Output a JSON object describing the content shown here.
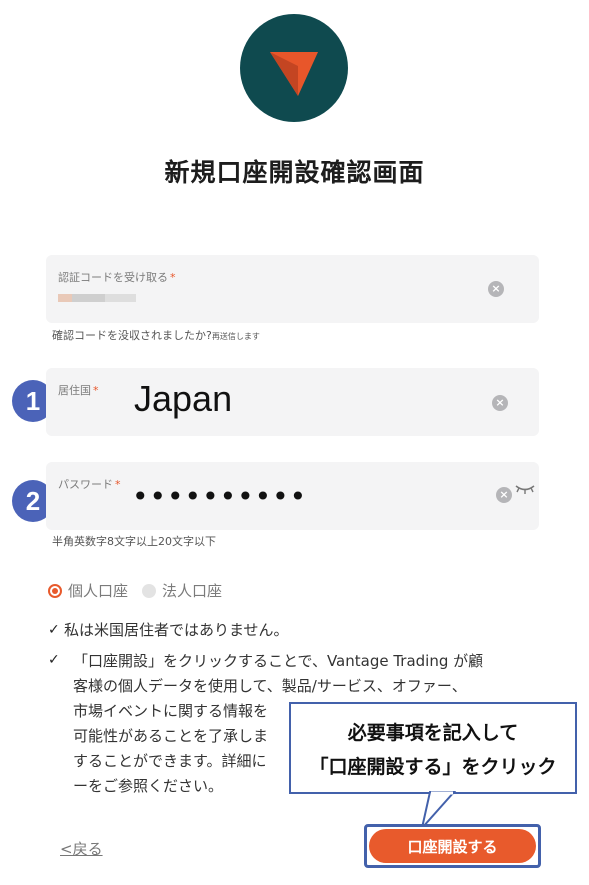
{
  "header": {
    "title": "新規口座開設確認画面"
  },
  "verification": {
    "label": "認証コードを受け取る",
    "required_mark": "*",
    "hint_main": "確認コードを没収されましたか?",
    "hint_link": "再送信します"
  },
  "residence": {
    "label": "居住国",
    "required_mark": "*",
    "value": "Japan",
    "step_number": "1"
  },
  "password": {
    "label": "パスワード",
    "required_mark": "*",
    "value": "••••••••••",
    "step_number": "2",
    "hint": "半角英数字8文字以上20文字以下"
  },
  "account_type": {
    "options": [
      "個人口座",
      "法人口座"
    ],
    "selected": "個人口座"
  },
  "agreements": {
    "us_resident": "私は米国居住者ではありません。",
    "consent_lines": [
      "「口座開設」をクリックすることで、Vantage Trading が顧",
      "客様の個人データを使用して、製品/サービス、オファー、",
      "市場イベントに関する情報を",
      "可能性があることを了承しま",
      "することができます。詳細に",
      "ーをご参照ください。"
    ]
  },
  "callout": {
    "line1": "必要事項を記入して",
    "line2": "「口座開設する」をクリック"
  },
  "actions": {
    "back_label": "<戻る",
    "submit_label": "口座開設する"
  },
  "colors": {
    "brand_dark": "#0f4a4f",
    "accent_orange": "#e85a2c",
    "annotation_blue": "#4361ab",
    "step_badge": "#4b63b8"
  }
}
